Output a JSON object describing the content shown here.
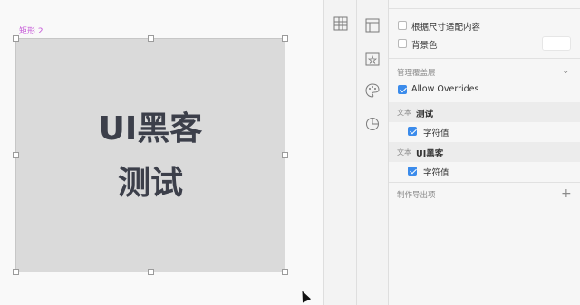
{
  "canvas": {
    "artboard_label": "矩形 2",
    "text_line1": "UI黑客",
    "text_line2": "测试"
  },
  "inspector": {
    "fit_content_label": "根据尺寸适配内容",
    "background_label": "背景色",
    "overrides_section": "管理覆盖层",
    "allow_overrides_label": "Allow Overrides",
    "group1_tag": "文本",
    "group1_name": "测试",
    "group1_value_label": "字符值",
    "group2_tag": "文本",
    "group2_name": "UI黑客",
    "group2_value_label": "字符值",
    "export_label": "制作导出项"
  },
  "colors": {
    "accent": "#3b8beb",
    "artboard_label": "#c65ad8",
    "rect_fill": "#dadada",
    "text": "#3c3f4a"
  }
}
